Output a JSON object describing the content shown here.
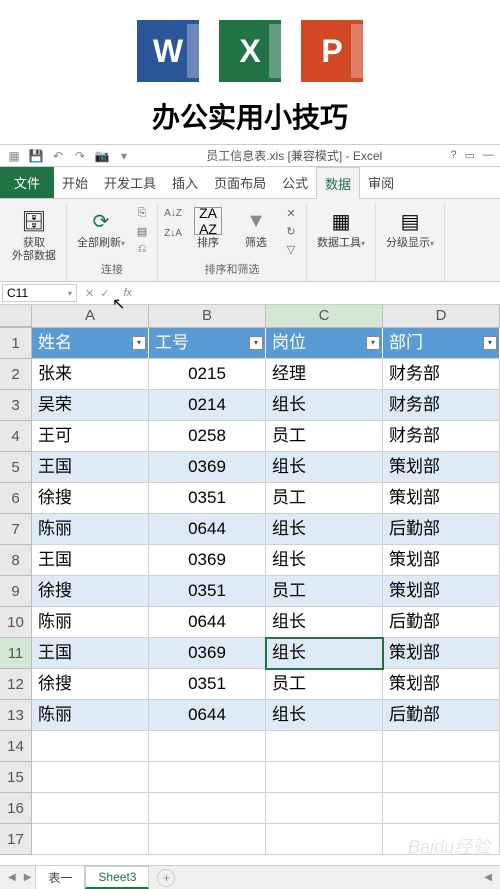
{
  "hero_title": "办公实用小技巧",
  "title_bar": {
    "doc": "员工信息表.xls [兼容模式] - Excel",
    "help": "?",
    "min": "—"
  },
  "tabs": {
    "file": "文件",
    "home": "开始",
    "dev": "开发工具",
    "insert": "插入",
    "layout": "页面布局",
    "formula": "公式",
    "data": "数据",
    "review": "审阅"
  },
  "ribbon": {
    "get_data": "获取\n外部数据",
    "refresh": "全部刷新",
    "connections": "连接",
    "sort": "排序",
    "filter": "筛选",
    "sort_filter": "排序和筛选",
    "data_tools": "数据工具",
    "outline": "分级显示"
  },
  "namebox": "C11",
  "columns": [
    "A",
    "B",
    "C",
    "D"
  ],
  "chart_data": {
    "type": "table",
    "headers": [
      "姓名",
      "工号",
      "岗位",
      "部门"
    ],
    "rows": [
      [
        "张来",
        "0215",
        "经理",
        "财务部"
      ],
      [
        "吴荣",
        "0214",
        "组长",
        "财务部"
      ],
      [
        "王可",
        "0258",
        "员工",
        "财务部"
      ],
      [
        "王国",
        "0369",
        "组长",
        "策划部"
      ],
      [
        "徐搜",
        "0351",
        "员工",
        "策划部"
      ],
      [
        "陈丽",
        "0644",
        "组长",
        "后勤部"
      ],
      [
        "王国",
        "0369",
        "组长",
        "策划部"
      ],
      [
        "徐搜",
        "0351",
        "员工",
        "策划部"
      ],
      [
        "陈丽",
        "0644",
        "组长",
        "后勤部"
      ],
      [
        "王国",
        "0369",
        "组长",
        "策划部"
      ],
      [
        "徐搜",
        "0351",
        "员工",
        "策划部"
      ],
      [
        "陈丽",
        "0644",
        "组长",
        "后勤部"
      ]
    ]
  },
  "empty_rows": [
    14,
    15,
    16,
    17
  ],
  "sheet_tabs": {
    "t1": "表一",
    "t2": "Sheet3",
    "add": "+"
  },
  "watermark": "Baidu经验"
}
